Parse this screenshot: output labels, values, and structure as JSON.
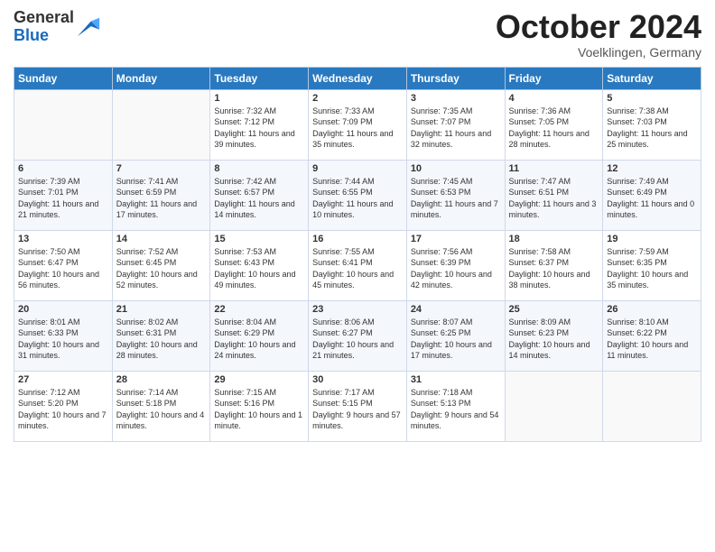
{
  "logo": {
    "line1": "General",
    "line2": "Blue"
  },
  "title": "October 2024",
  "subtitle": "Voelklingen, Germany",
  "weekdays": [
    "Sunday",
    "Monday",
    "Tuesday",
    "Wednesday",
    "Thursday",
    "Friday",
    "Saturday"
  ],
  "weeks": [
    [
      {
        "day": "",
        "info": ""
      },
      {
        "day": "",
        "info": ""
      },
      {
        "day": "1",
        "info": "Sunrise: 7:32 AM\nSunset: 7:12 PM\nDaylight: 11 hours and 39 minutes."
      },
      {
        "day": "2",
        "info": "Sunrise: 7:33 AM\nSunset: 7:09 PM\nDaylight: 11 hours and 35 minutes."
      },
      {
        "day": "3",
        "info": "Sunrise: 7:35 AM\nSunset: 7:07 PM\nDaylight: 11 hours and 32 minutes."
      },
      {
        "day": "4",
        "info": "Sunrise: 7:36 AM\nSunset: 7:05 PM\nDaylight: 11 hours and 28 minutes."
      },
      {
        "day": "5",
        "info": "Sunrise: 7:38 AM\nSunset: 7:03 PM\nDaylight: 11 hours and 25 minutes."
      }
    ],
    [
      {
        "day": "6",
        "info": "Sunrise: 7:39 AM\nSunset: 7:01 PM\nDaylight: 11 hours and 21 minutes."
      },
      {
        "day": "7",
        "info": "Sunrise: 7:41 AM\nSunset: 6:59 PM\nDaylight: 11 hours and 17 minutes."
      },
      {
        "day": "8",
        "info": "Sunrise: 7:42 AM\nSunset: 6:57 PM\nDaylight: 11 hours and 14 minutes."
      },
      {
        "day": "9",
        "info": "Sunrise: 7:44 AM\nSunset: 6:55 PM\nDaylight: 11 hours and 10 minutes."
      },
      {
        "day": "10",
        "info": "Sunrise: 7:45 AM\nSunset: 6:53 PM\nDaylight: 11 hours and 7 minutes."
      },
      {
        "day": "11",
        "info": "Sunrise: 7:47 AM\nSunset: 6:51 PM\nDaylight: 11 hours and 3 minutes."
      },
      {
        "day": "12",
        "info": "Sunrise: 7:49 AM\nSunset: 6:49 PM\nDaylight: 11 hours and 0 minutes."
      }
    ],
    [
      {
        "day": "13",
        "info": "Sunrise: 7:50 AM\nSunset: 6:47 PM\nDaylight: 10 hours and 56 minutes."
      },
      {
        "day": "14",
        "info": "Sunrise: 7:52 AM\nSunset: 6:45 PM\nDaylight: 10 hours and 52 minutes."
      },
      {
        "day": "15",
        "info": "Sunrise: 7:53 AM\nSunset: 6:43 PM\nDaylight: 10 hours and 49 minutes."
      },
      {
        "day": "16",
        "info": "Sunrise: 7:55 AM\nSunset: 6:41 PM\nDaylight: 10 hours and 45 minutes."
      },
      {
        "day": "17",
        "info": "Sunrise: 7:56 AM\nSunset: 6:39 PM\nDaylight: 10 hours and 42 minutes."
      },
      {
        "day": "18",
        "info": "Sunrise: 7:58 AM\nSunset: 6:37 PM\nDaylight: 10 hours and 38 minutes."
      },
      {
        "day": "19",
        "info": "Sunrise: 7:59 AM\nSunset: 6:35 PM\nDaylight: 10 hours and 35 minutes."
      }
    ],
    [
      {
        "day": "20",
        "info": "Sunrise: 8:01 AM\nSunset: 6:33 PM\nDaylight: 10 hours and 31 minutes."
      },
      {
        "day": "21",
        "info": "Sunrise: 8:02 AM\nSunset: 6:31 PM\nDaylight: 10 hours and 28 minutes."
      },
      {
        "day": "22",
        "info": "Sunrise: 8:04 AM\nSunset: 6:29 PM\nDaylight: 10 hours and 24 minutes."
      },
      {
        "day": "23",
        "info": "Sunrise: 8:06 AM\nSunset: 6:27 PM\nDaylight: 10 hours and 21 minutes."
      },
      {
        "day": "24",
        "info": "Sunrise: 8:07 AM\nSunset: 6:25 PM\nDaylight: 10 hours and 17 minutes."
      },
      {
        "day": "25",
        "info": "Sunrise: 8:09 AM\nSunset: 6:23 PM\nDaylight: 10 hours and 14 minutes."
      },
      {
        "day": "26",
        "info": "Sunrise: 8:10 AM\nSunset: 6:22 PM\nDaylight: 10 hours and 11 minutes."
      }
    ],
    [
      {
        "day": "27",
        "info": "Sunrise: 7:12 AM\nSunset: 5:20 PM\nDaylight: 10 hours and 7 minutes."
      },
      {
        "day": "28",
        "info": "Sunrise: 7:14 AM\nSunset: 5:18 PM\nDaylight: 10 hours and 4 minutes."
      },
      {
        "day": "29",
        "info": "Sunrise: 7:15 AM\nSunset: 5:16 PM\nDaylight: 10 hours and 1 minute."
      },
      {
        "day": "30",
        "info": "Sunrise: 7:17 AM\nSunset: 5:15 PM\nDaylight: 9 hours and 57 minutes."
      },
      {
        "day": "31",
        "info": "Sunrise: 7:18 AM\nSunset: 5:13 PM\nDaylight: 9 hours and 54 minutes."
      },
      {
        "day": "",
        "info": ""
      },
      {
        "day": "",
        "info": ""
      }
    ]
  ]
}
